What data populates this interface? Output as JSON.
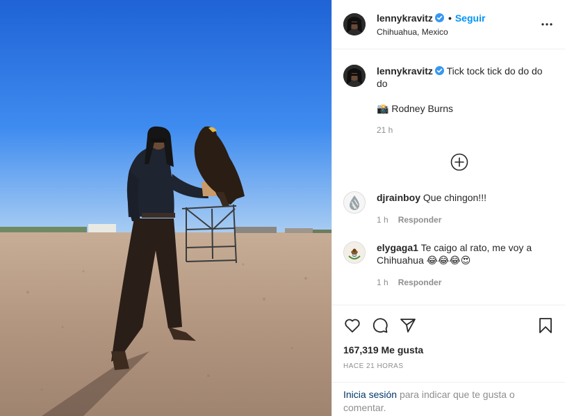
{
  "header": {
    "username": "lennykravitz",
    "dot": "•",
    "follow_label": "Seguir",
    "location": "Chihuahua, Mexico"
  },
  "caption": {
    "username": "lennykravitz",
    "text": "Tick tock tick do do do do",
    "credit_emoji": "📸",
    "credit": "Rodney Burns",
    "time": "21 h"
  },
  "comments": [
    {
      "username": "djrainboy",
      "text": "Que chingon!!!",
      "time": "1 h",
      "reply_label": "Responder"
    },
    {
      "username": "elygaga1",
      "text": "Te caigo al rato, me voy a Chihuahua",
      "emojis": "😂😂😂😍",
      "time": "1 h",
      "reply_label": "Responder"
    }
  ],
  "actions": {
    "likes": "167,319 Me gusta",
    "time_ago": "HACE 21 HORAS"
  },
  "login": {
    "link": "Inicia sesión",
    "text": "para indicar que te gusta o comentar."
  },
  "colors": {
    "accent": "#0095f6",
    "link_dark": "#00376b",
    "muted": "#8e8e8e",
    "sky_top": "#2a6fd9",
    "ground": "#b59a86"
  },
  "icons": [
    "verified-badge-icon",
    "more-options-icon",
    "load-more-plus-icon",
    "heart-icon",
    "comment-icon",
    "share-icon",
    "bookmark-icon"
  ]
}
